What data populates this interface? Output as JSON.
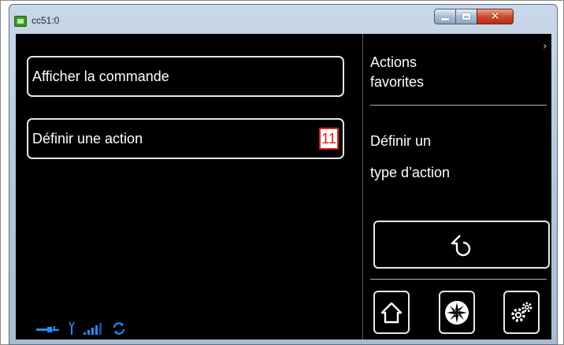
{
  "window": {
    "title": "cc51:0",
    "minimize_icon": "minimize-icon",
    "maximize_icon": "maximize-icon",
    "close_icon": "close-icon",
    "close_color": "#cf4a2b"
  },
  "menu": {
    "items": [
      {
        "label": "Afficher la commande"
      },
      {
        "label": "Définir une action",
        "badge": "11"
      }
    ]
  },
  "status_bar": {
    "icons": [
      "connection-icon",
      "antenna-icon",
      "signal-strength-icon",
      "sync-icon"
    ],
    "color": "#1f8fff"
  },
  "side_panel": {
    "title_line1": "Actions",
    "title_line2": "favorites",
    "description_line1": "Définir un",
    "description_line2": "type d’action",
    "back_icon": "back-arrow-icon",
    "nav_icons": [
      "home-icon",
      "fan-icon",
      "settings-icon"
    ]
  },
  "colors": {
    "screen_background": "#000000",
    "badge_border": "#e21b1b",
    "button_border": "#e6e6e6"
  }
}
